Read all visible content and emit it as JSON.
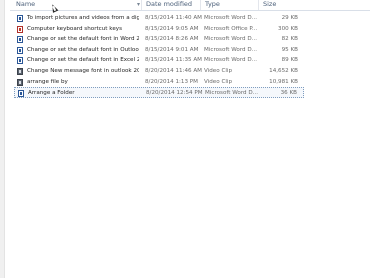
{
  "header": {
    "name": "Name",
    "date": "Date modified",
    "type": "Type",
    "size": "Size"
  },
  "files": [
    {
      "name": "To import pictures and videos from a dig...",
      "date": "8/15/2014 11:40 AM",
      "type": "Microsoft Word D...",
      "size": "29 KB",
      "icon": "word-doc-icon",
      "selected": false
    },
    {
      "name": "Computer keyboard shortcut keys",
      "date": "8/15/2014 9:05 AM",
      "type": "Microsoft Office P...",
      "size": "300 KB",
      "icon": "office-doc-icon",
      "selected": false
    },
    {
      "name": "Change or set the default font in Word 2...",
      "date": "8/15/2014 8:26 AM",
      "type": "Microsoft Word D...",
      "size": "82 KB",
      "icon": "word-doc-icon",
      "selected": false
    },
    {
      "name": "Change or set the default font in Outlook...",
      "date": "8/15/2014 9:01 AM",
      "type": "Microsoft Word D...",
      "size": "95 KB",
      "icon": "word-doc-icon",
      "selected": false
    },
    {
      "name": "Change or set the default font in Excel 20...",
      "date": "8/15/2014 11:35 AM",
      "type": "Microsoft Word D...",
      "size": "89 KB",
      "icon": "word-doc-icon",
      "selected": false
    },
    {
      "name": "Change New message font in outlook 2010",
      "date": "8/20/2014 11:46 AM",
      "type": "Video Clip",
      "size": "14,652 KB",
      "icon": "video-clip-icon",
      "selected": false
    },
    {
      "name": "arrange file by",
      "date": "8/20/2014 1:13 PM",
      "type": "Video Clip",
      "size": "10,981 KB",
      "icon": "video-clip-icon",
      "selected": false
    },
    {
      "name": "Arrange a Folder",
      "date": "8/20/2014 12:54 PM",
      "type": "Microsoft Word D...",
      "size": "36 KB",
      "icon": "word-doc-icon",
      "selected": true
    }
  ]
}
